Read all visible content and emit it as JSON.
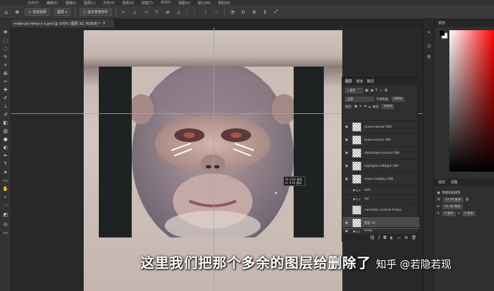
{
  "menubar": {
    "items": [
      "文件(F)",
      "编辑(E)",
      "图像(I)",
      "图层(L)",
      "文字(Y)",
      "选择(S)",
      "滤镜(T)",
      "3D(D)",
      "视图(V)",
      "窗口(W)",
      "帮助(H)"
    ]
  },
  "options": {
    "auto_select_label": "自动选择",
    "target": "图层",
    "transform_label": "显示变换控件"
  },
  "document": {
    "tab_title": "make-pic-temp-c-1.psd @ 100% (图层 32, RGB/8) *"
  },
  "measure": {
    "line1": "W: 0.61 厘米",
    "line2": "H: 0.61 厘米"
  },
  "layers": {
    "tabs": [
      "图层",
      "通道",
      "路径"
    ],
    "filter_label": "类型",
    "blend_mode": "正常",
    "opacity_label": "不透明度:",
    "opacity_value": "100%",
    "lock_label": "锁定:",
    "fill_label": "填充:",
    "fill_value": "100%",
    "rows": [
      {
        "name": "mask-normal-180",
        "kind": "layer"
      },
      {
        "name": "brow-normal-180",
        "kind": "layer"
      },
      {
        "name": "darkshape-normal-180",
        "kind": "layer"
      },
      {
        "name": "highlight-softlight-180",
        "kind": "layer"
      },
      {
        "name": "mask-multiply-180",
        "kind": "layer"
      },
      {
        "name": "edit",
        "kind": "folder"
      },
      {
        "name": "fat",
        "kind": "folder"
      },
      {
        "name": "cosmetic-content-frame",
        "kind": "layer"
      },
      {
        "name": "图层 32",
        "kind": "selected"
      },
      {
        "name": "temp",
        "kind": "folder"
      }
    ]
  },
  "right": {
    "color_tab": "颜色",
    "props_tabs": [
      "属性",
      "调整"
    ],
    "props_title": "像素图层属性",
    "w_label": "W:",
    "w_value": "24.48 厘米",
    "h_label": "H:",
    "h_value": "24.48 厘米",
    "x_label": "X:",
    "x_value": "0 厘米",
    "y_label": "Y:",
    "y_value": "0 厘米"
  },
  "overlay": {
    "subtitle": "这里我们把那个多余的图层给删除了",
    "watermark": "知乎 @若隐若现"
  }
}
